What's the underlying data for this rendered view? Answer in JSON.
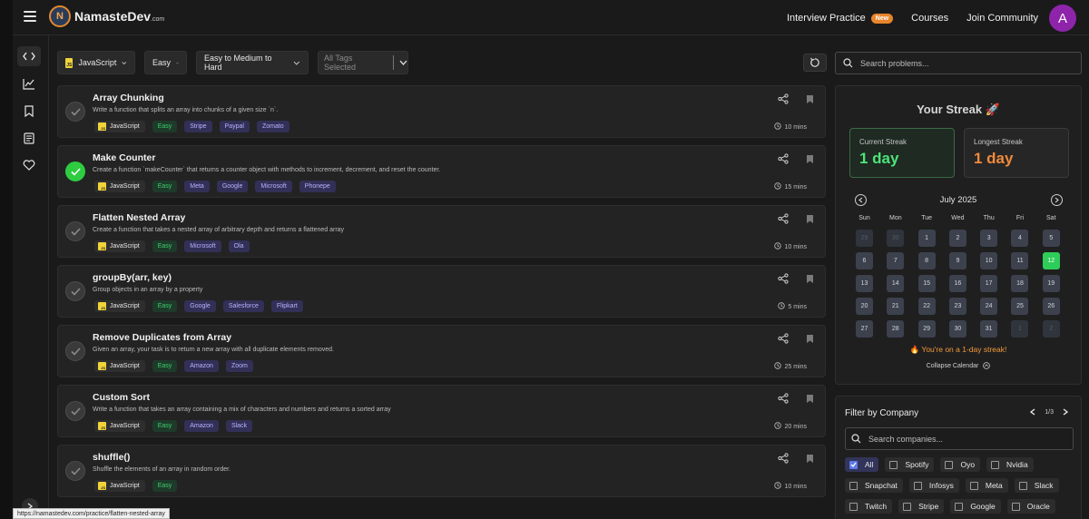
{
  "header": {
    "logo_text": "NamasteDev",
    "logo_suffix": ".com",
    "nav": [
      {
        "label": "Interview Practice",
        "badge": "New"
      },
      {
        "label": "Courses"
      },
      {
        "label": "Join Community"
      }
    ],
    "avatar_letter": "A",
    "avatar_color": "#8e24aa"
  },
  "sidebar": {
    "icons": [
      "code-icon",
      "chart-icon",
      "bookmark-icon",
      "notes-icon",
      "heart-icon"
    ],
    "expand_icon": "chevron-right-icon"
  },
  "filters": {
    "language": "JavaScript",
    "difficulty": "Easy",
    "range": "Easy to Medium to Hard",
    "tags_placeholder": "All Tags Selected",
    "search_placeholder": "Search problems..."
  },
  "problems": [
    {
      "title": "Array Chunking",
      "desc": "Write a function that splits an array into chunks of a given size `n`.",
      "lang": "JavaScript",
      "difficulty": "Easy",
      "companies": [
        "Stripe",
        "Paypal",
        "Zomato"
      ],
      "time": "10 mins",
      "solved": false
    },
    {
      "title": "Make Counter",
      "desc": "Create a function `makeCounter` that returns a counter object with methods to increment, decrement, and reset the counter.",
      "lang": "JavaScript",
      "difficulty": "Easy",
      "companies": [
        "Meta",
        "Google",
        "Microsoft",
        "Phonepe"
      ],
      "time": "15 mins",
      "solved": true
    },
    {
      "title": "Flatten Nested Array",
      "desc": "Create a function that takes a nested array of arbitrary depth and returns a flattened array",
      "lang": "JavaScript",
      "difficulty": "Easy",
      "companies": [
        "Microsoft",
        "Ola"
      ],
      "time": "10 mins",
      "solved": false
    },
    {
      "title": "groupBy(arr, key)",
      "desc": "Group objects in an array by a property",
      "lang": "JavaScript",
      "difficulty": "Easy",
      "companies": [
        "Google",
        "Salesforce",
        "Flipkart"
      ],
      "time": "5 mins",
      "solved": false
    },
    {
      "title": "Remove Duplicates from Array",
      "desc": "Given an array, your task is to return a new array with all duplicate elements removed.",
      "lang": "JavaScript",
      "difficulty": "Easy",
      "companies": [
        "Amazon",
        "Zoom"
      ],
      "time": "25 mins",
      "solved": false
    },
    {
      "title": "Custom Sort",
      "desc": "Write a function that takes an array containing a mix of characters and numbers and returns a sorted array",
      "lang": "JavaScript",
      "difficulty": "Easy",
      "companies": [
        "Amazon",
        "Slack"
      ],
      "time": "20 mins",
      "solved": false
    },
    {
      "title": "shuffle()",
      "desc": "Shuffle the elements of an array in random order.",
      "lang": "JavaScript",
      "difficulty": "Easy",
      "companies": [],
      "time": "10 mins",
      "solved": false
    }
  ],
  "streak": {
    "title": "Your Streak 🚀",
    "current_label": "Current Streak",
    "current_value": "1 day",
    "longest_label": "Longest Streak",
    "longest_value": "1 day",
    "month": "July 2025",
    "weekdays": [
      "Sun",
      "Mon",
      "Tue",
      "Wed",
      "Thu",
      "Fri",
      "Sat"
    ],
    "days": [
      {
        "d": "29",
        "other": true
      },
      {
        "d": "30",
        "other": true
      },
      {
        "d": "1"
      },
      {
        "d": "2"
      },
      {
        "d": "3"
      },
      {
        "d": "4"
      },
      {
        "d": "5"
      },
      {
        "d": "6"
      },
      {
        "d": "7"
      },
      {
        "d": "8"
      },
      {
        "d": "9"
      },
      {
        "d": "10"
      },
      {
        "d": "11"
      },
      {
        "d": "12",
        "today": true
      },
      {
        "d": "13"
      },
      {
        "d": "14"
      },
      {
        "d": "15"
      },
      {
        "d": "16"
      },
      {
        "d": "17"
      },
      {
        "d": "18"
      },
      {
        "d": "19"
      },
      {
        "d": "20"
      },
      {
        "d": "21"
      },
      {
        "d": "22"
      },
      {
        "d": "23"
      },
      {
        "d": "24"
      },
      {
        "d": "25"
      },
      {
        "d": "26"
      },
      {
        "d": "27"
      },
      {
        "d": "28"
      },
      {
        "d": "29"
      },
      {
        "d": "30"
      },
      {
        "d": "31"
      },
      {
        "d": "1",
        "other": true
      },
      {
        "d": "2",
        "other": true
      }
    ],
    "message": "🔥 You're on a 1-day streak!",
    "collapse_label": "Collapse Calendar"
  },
  "company_filter": {
    "title": "Filter by Company",
    "page": "1/3",
    "search_placeholder": "Search companies...",
    "companies": [
      {
        "name": "All",
        "checked": true
      },
      {
        "name": "Spotify"
      },
      {
        "name": "Oyo"
      },
      {
        "name": "Nvidia"
      },
      {
        "name": "Snapchat"
      },
      {
        "name": "Infosys"
      },
      {
        "name": "Meta"
      },
      {
        "name": "Slack"
      },
      {
        "name": "Twitch"
      },
      {
        "name": "Stripe"
      },
      {
        "name": "Google"
      },
      {
        "name": "Oracle"
      }
    ]
  },
  "status_url": "https://namastedev.com/practice/flatten-nested-array",
  "colors": {
    "accent_green": "#2ecc40",
    "accent_orange": "#f08a3a",
    "bg": "#1a1a1a"
  }
}
